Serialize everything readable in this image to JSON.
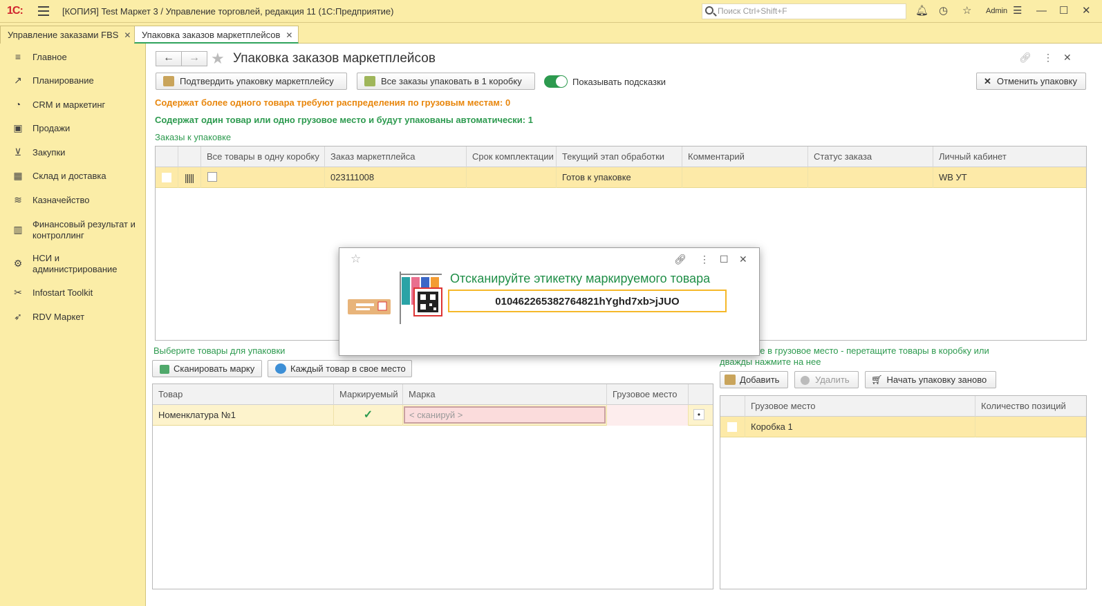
{
  "window": {
    "logo": "1С:",
    "title": "[КОПИЯ] Test Маркет 3 / Управление торговлей, редакция 11  (1С:Предприятие)",
    "search_placeholder": "Поиск Ctrl+Shift+F",
    "user": "Admin"
  },
  "tabs": [
    {
      "label": "Управление заказами FBS",
      "close": "✕"
    },
    {
      "label": "Упаковка заказов маркетплейсов",
      "close": "✕"
    }
  ],
  "sidebar": {
    "items": [
      {
        "label": "Главное",
        "icon": "menu-icon"
      },
      {
        "label": "Планирование",
        "icon": "chart-icon"
      },
      {
        "label": "CRM и маркетинг",
        "icon": "pie-icon"
      },
      {
        "label": "Продажи",
        "icon": "bag-icon"
      },
      {
        "label": "Закупки",
        "icon": "cart-icon"
      },
      {
        "label": "Склад и доставка",
        "icon": "warehouse-icon"
      },
      {
        "label": "Казначейство",
        "icon": "coins-icon"
      },
      {
        "label": "Финансовый результат и контроллинг",
        "icon": "bars-icon"
      },
      {
        "label": "НСИ и администрирование",
        "icon": "gear-icon"
      },
      {
        "label": "Infostart Toolkit",
        "icon": "tools-icon"
      },
      {
        "label": "RDV Маркет",
        "icon": "rocket-icon"
      }
    ]
  },
  "page": {
    "title": "Упаковка заказов маркетплейсов",
    "confirm_button": "Подтвердить упаковку маркетплейсу",
    "pack_all_button": "Все заказы упаковать в 1 коробку",
    "hints_toggle": "Показывать подсказки",
    "cancel_button": "Отменить упаковку",
    "info_multi": "Содержат более одного товара требуют распределения по грузовым местам: 0",
    "info_single": "Содержат один товар или одно грузовое место и будут упакованы автоматически: 1",
    "orders_label": "Заказы к упаковке"
  },
  "orders_table": {
    "columns": [
      "",
      "",
      "Все товары в одну коробку",
      "Заказ маркетплейса",
      "Срок комплектации",
      "Текущий этап обработки",
      "Комментарий",
      "Статус заказа",
      "Личный кабинет"
    ],
    "rows": [
      {
        "order": "023111008",
        "deadline": "",
        "stage": "Готов к упаковке",
        "comment": "",
        "status": "",
        "cabinet": "WB УТ"
      }
    ]
  },
  "goods_section": {
    "label": "Выберите товары для упаковки",
    "scan_button": "Сканировать марку",
    "each_button": "Каждый товар в свое место",
    "columns": [
      "Товар",
      "Маркируемый",
      "Марка",
      "Грузовое место",
      ""
    ],
    "rows": [
      {
        "item": "Номенклатура №1",
        "marked": "✓",
        "mark": "< сканируй >",
        "place": "",
        "dot": "•"
      }
    ]
  },
  "places_section": {
    "label": "Поместите в грузовое место - перетащите товары в коробку или дважды нажмите на нее",
    "add_button": "Добавить",
    "delete_button": "Удалить",
    "restart_button": "Начать упаковку заново",
    "columns": [
      "",
      "Грузовое место",
      "Количество позиций"
    ],
    "rows": [
      {
        "place": "Коробка 1",
        "count": ""
      }
    ]
  },
  "dialog": {
    "title": "Отсканируйте этикетку маркируемого товара",
    "value": "010462265382764821hYghd7xb>jJUO"
  },
  "colors": {
    "accent_yellow": "#FBEDA7",
    "green": "#2d9a4f",
    "orange": "#e8860c",
    "row_highlight": "#fdeaa8",
    "input_border": "#f5b829"
  }
}
